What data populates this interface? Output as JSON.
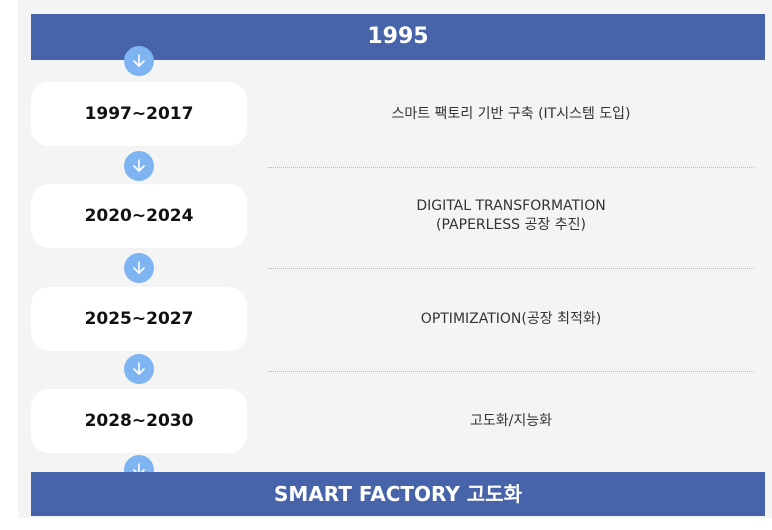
{
  "header": {
    "title": "1995"
  },
  "timeline": [
    {
      "period": "1997~2017",
      "lines": [
        "스마트 팩토리 기반 구축 (IT시스템 도입)"
      ]
    },
    {
      "period": "2020~2024",
      "lines": [
        "DIGITAL TRANSFORMATION",
        "(PAPERLESS 공장 추진)"
      ]
    },
    {
      "period": "2025~2027",
      "lines": [
        "OPTIMIZATION(공장 최적화)"
      ]
    },
    {
      "period": "2028~2030",
      "lines": [
        "고도화/지능화"
      ]
    }
  ],
  "footer": {
    "title": "SMART FACTORY 고도화"
  },
  "colors": {
    "banner": "#4763aa",
    "arrow": "#7fb4f2",
    "panel": "#f4f4f4"
  },
  "icons": {
    "step": "arrow-down-icon"
  }
}
